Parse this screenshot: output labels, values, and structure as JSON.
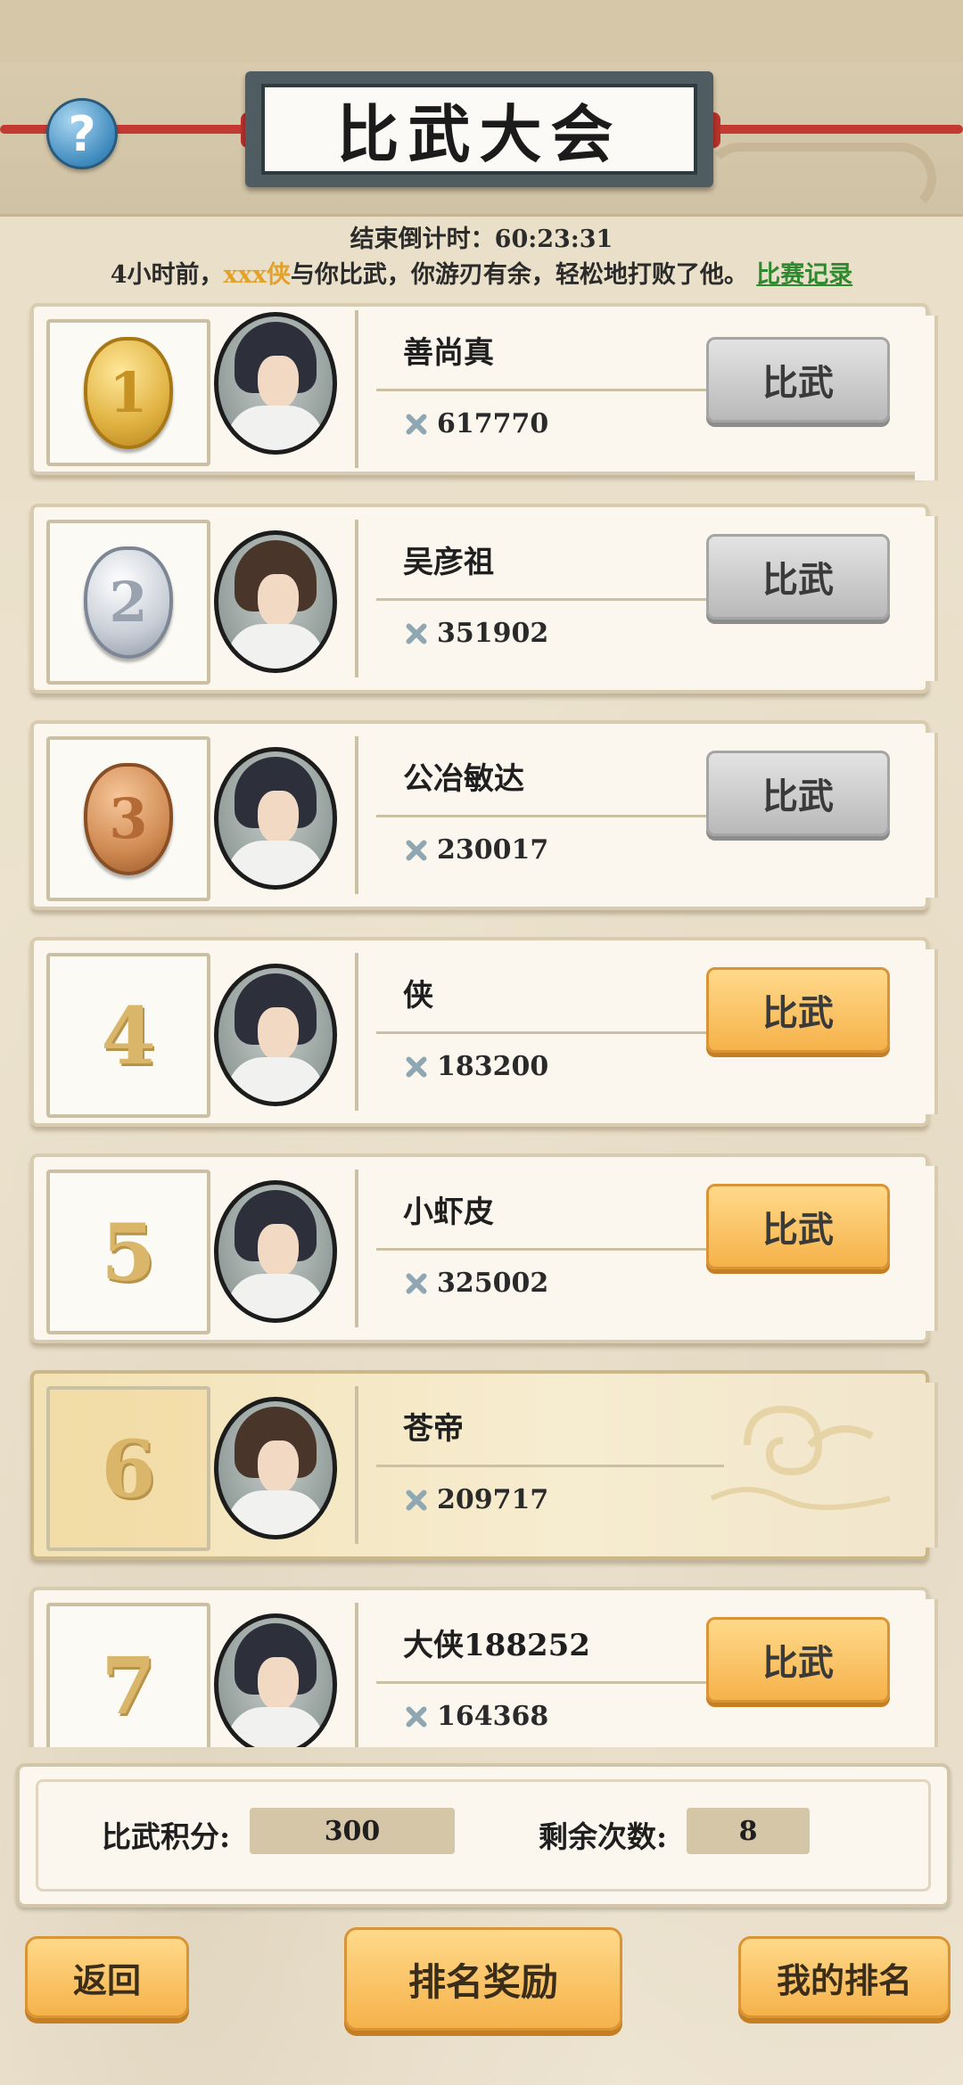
{
  "header": {
    "help_symbol": "?",
    "title": "比武大会",
    "countdown_label": "结束倒计时：",
    "countdown_value": "60:23:31",
    "notice_prefix": "4小时前，",
    "notice_name": "xxx侠",
    "notice_suffix": "与你比武，你游刃有余，轻松地打败了他。",
    "record_link": "比赛记录"
  },
  "entries": [
    {
      "rank": "1",
      "name": "善尚真",
      "power": "617770",
      "button": "比武"
    },
    {
      "rank": "2",
      "name": "吴彦祖",
      "power": "351902",
      "button": "比武"
    },
    {
      "rank": "3",
      "name": "公冶敏达",
      "power": "230017",
      "button": "比武"
    },
    {
      "rank": "4",
      "name": "侠",
      "power": "183200",
      "button": "比武"
    },
    {
      "rank": "5",
      "name": "小虾皮",
      "power": "325002",
      "button": "比武"
    },
    {
      "rank": "6",
      "name": "苍帝",
      "power": "209717",
      "button": ""
    },
    {
      "rank": "7",
      "name": "大侠188252",
      "power": "164368",
      "button": "比武"
    }
  ],
  "stats": {
    "score_label": "比武积分:",
    "score_value": "300",
    "remaining_label": "剩余次数:",
    "remaining_value": "8"
  },
  "buttons": {
    "back": "返回",
    "rank_reward": "排名奖励",
    "my_rank": "我的排名"
  },
  "colors": {
    "accent_orange": "#f6b24a",
    "link_green": "#2f8a2f",
    "highlight_name": "#e2a22a"
  }
}
